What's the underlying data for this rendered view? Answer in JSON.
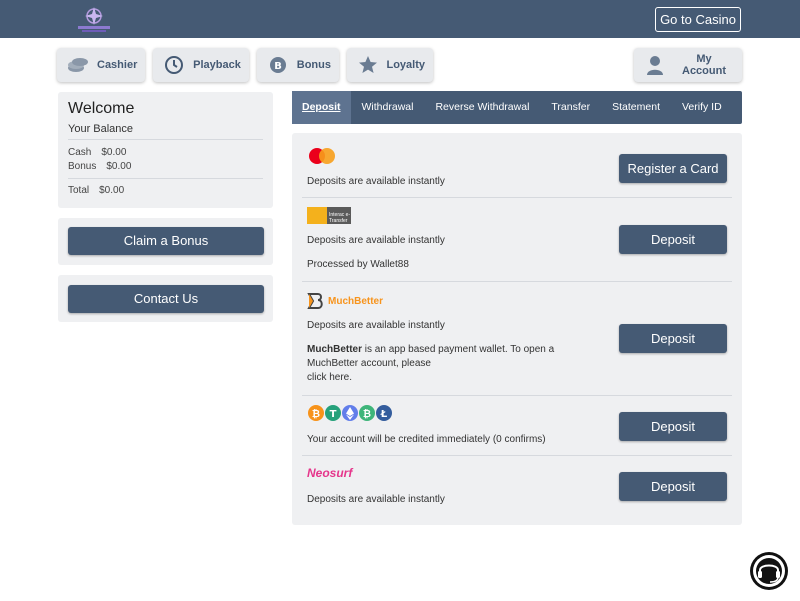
{
  "topbar": {
    "go_casino": "Go to Casino",
    "bg": "#455a74"
  },
  "nav": [
    {
      "label": "Cashier",
      "icon": "coins-icon"
    },
    {
      "label": "Playback",
      "icon": "history-icon"
    },
    {
      "label": "Bonus",
      "icon": "bonus-coin-icon"
    },
    {
      "label": "Loyalty",
      "icon": "star-icon"
    },
    {
      "label": "My Account",
      "icon": "user-icon"
    }
  ],
  "welcome": {
    "title": "Welcome",
    "your_balance": "Your Balance",
    "cash_label": "Cash",
    "cash_value": "$0.00",
    "bonus_label": "Bonus",
    "bonus_value": "$0.00",
    "total_label": "Total",
    "total_value": "$0.00"
  },
  "claim_bonus": "Claim a Bonus",
  "contact_us": "Contact Us",
  "tabs": [
    "Deposit",
    "Withdrawal",
    "Reverse Withdrawal",
    "Transfer",
    "Statement",
    "Verify ID"
  ],
  "methods": {
    "card": {
      "text": "Deposits are available instantly",
      "button": "Register a Card"
    },
    "etransfer": {
      "logo_text": "Interac e-Transfer",
      "text": "Deposits are available instantly",
      "processed": "Processed by Wallet88",
      "button": "Deposit"
    },
    "muchbetter": {
      "logo_name": "MuchBetter",
      "text": "Deposits are available instantly",
      "desc_bold": "MuchBetter",
      "desc": " is an app based payment wallet. To open a MuchBetter account, please",
      "link": "click here.",
      "button": "Deposit"
    },
    "crypto": {
      "text": "Your account will be credited immediately (0 confirms)",
      "button": "Deposit"
    },
    "neosurf": {
      "logo_name": "Neosurf",
      "text": "Deposits are available instantly",
      "button": "Deposit"
    }
  },
  "colors": {
    "accent": "#455a74",
    "panel": "#eff0f2",
    "muchbetter": "#f7941d",
    "neosurf": "#e5358b"
  }
}
